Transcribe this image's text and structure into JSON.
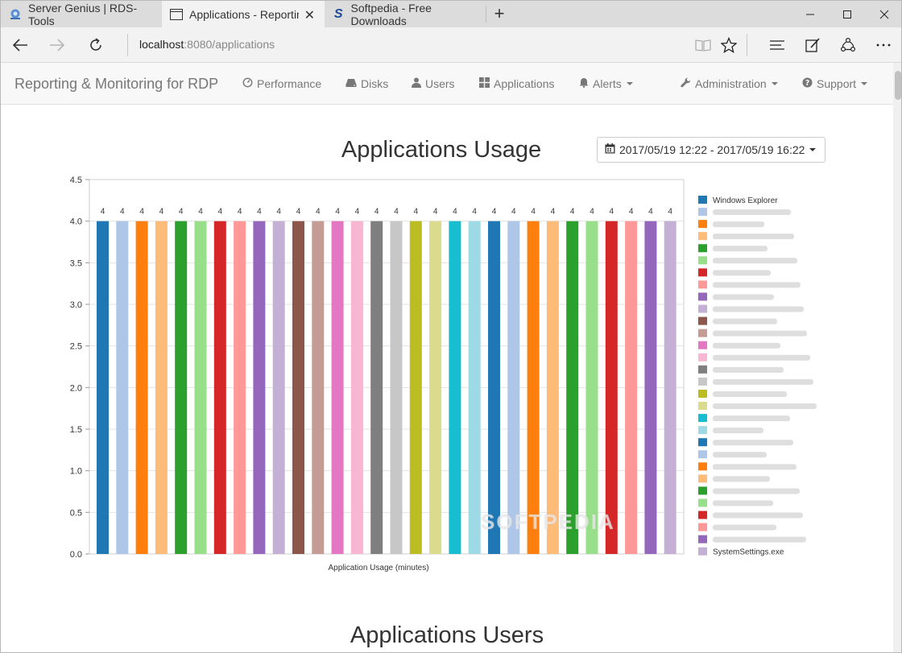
{
  "browser": {
    "tabs": [
      {
        "title": "Server Genius | RDS-Tools",
        "active": false
      },
      {
        "title": "Applications - Reporting",
        "active": true
      },
      {
        "title": "Softpedia - Free Downloads",
        "active": false
      }
    ],
    "url_host": "localhost",
    "url_rest": ":8080/applications"
  },
  "app": {
    "brand": "Reporting & Monitoring for RDP",
    "nav": {
      "performance": "Performance",
      "disks": "Disks",
      "users": "Users",
      "applications": "Applications",
      "alerts": "Alerts",
      "administration": "Administration",
      "support": "Support"
    }
  },
  "page": {
    "usage_title": "Applications Usage",
    "date_range": "2017/05/19 12:22 - 2017/05/19 16:22",
    "users_title": "Applications Users",
    "watermark": "SOFTPEDIA"
  },
  "chart_data": {
    "type": "bar",
    "xlabel": "Application Usage (minutes)",
    "ylim": [
      0,
      4.5
    ],
    "yticks": [
      0.0,
      0.5,
      1.0,
      1.5,
      2.0,
      2.5,
      3.0,
      3.5,
      4.0,
      4.5
    ],
    "values": [
      4,
      4,
      4,
      4,
      4,
      4,
      4,
      4,
      4,
      4,
      4,
      4,
      4,
      4,
      4,
      4,
      4,
      4,
      4,
      4,
      4,
      4,
      4,
      4,
      4,
      4,
      4,
      4,
      4,
      4
    ],
    "colors": [
      "#1f77b4",
      "#aec7e8",
      "#ff7f0e",
      "#ffbb78",
      "#2ca02c",
      "#98df8a",
      "#d62728",
      "#ff9896",
      "#9467bd",
      "#c5b0d5",
      "#8c564b",
      "#c49c94",
      "#e377c2",
      "#f7b6d2",
      "#7f7f7f",
      "#c7c7c7",
      "#bcbd22",
      "#dbdb8d",
      "#17becf",
      "#9edae5",
      "#1f77b4",
      "#aec7e8",
      "#ff7f0e",
      "#ffbb78",
      "#2ca02c",
      "#98df8a",
      "#d62728",
      "#ff9896",
      "#9467bd",
      "#c5b0d5"
    ],
    "legend": [
      "Windows Explorer",
      "",
      "",
      "",
      "",
      "",
      "",
      "",
      "",
      "",
      "",
      "",
      "",
      "",
      "",
      "",
      "",
      "",
      "",
      "",
      "",
      "",
      "",
      "",
      "",
      "",
      "",
      "",
      "",
      "SystemSettings.exe"
    ],
    "legend_placement": "right",
    "data_labels": true
  }
}
